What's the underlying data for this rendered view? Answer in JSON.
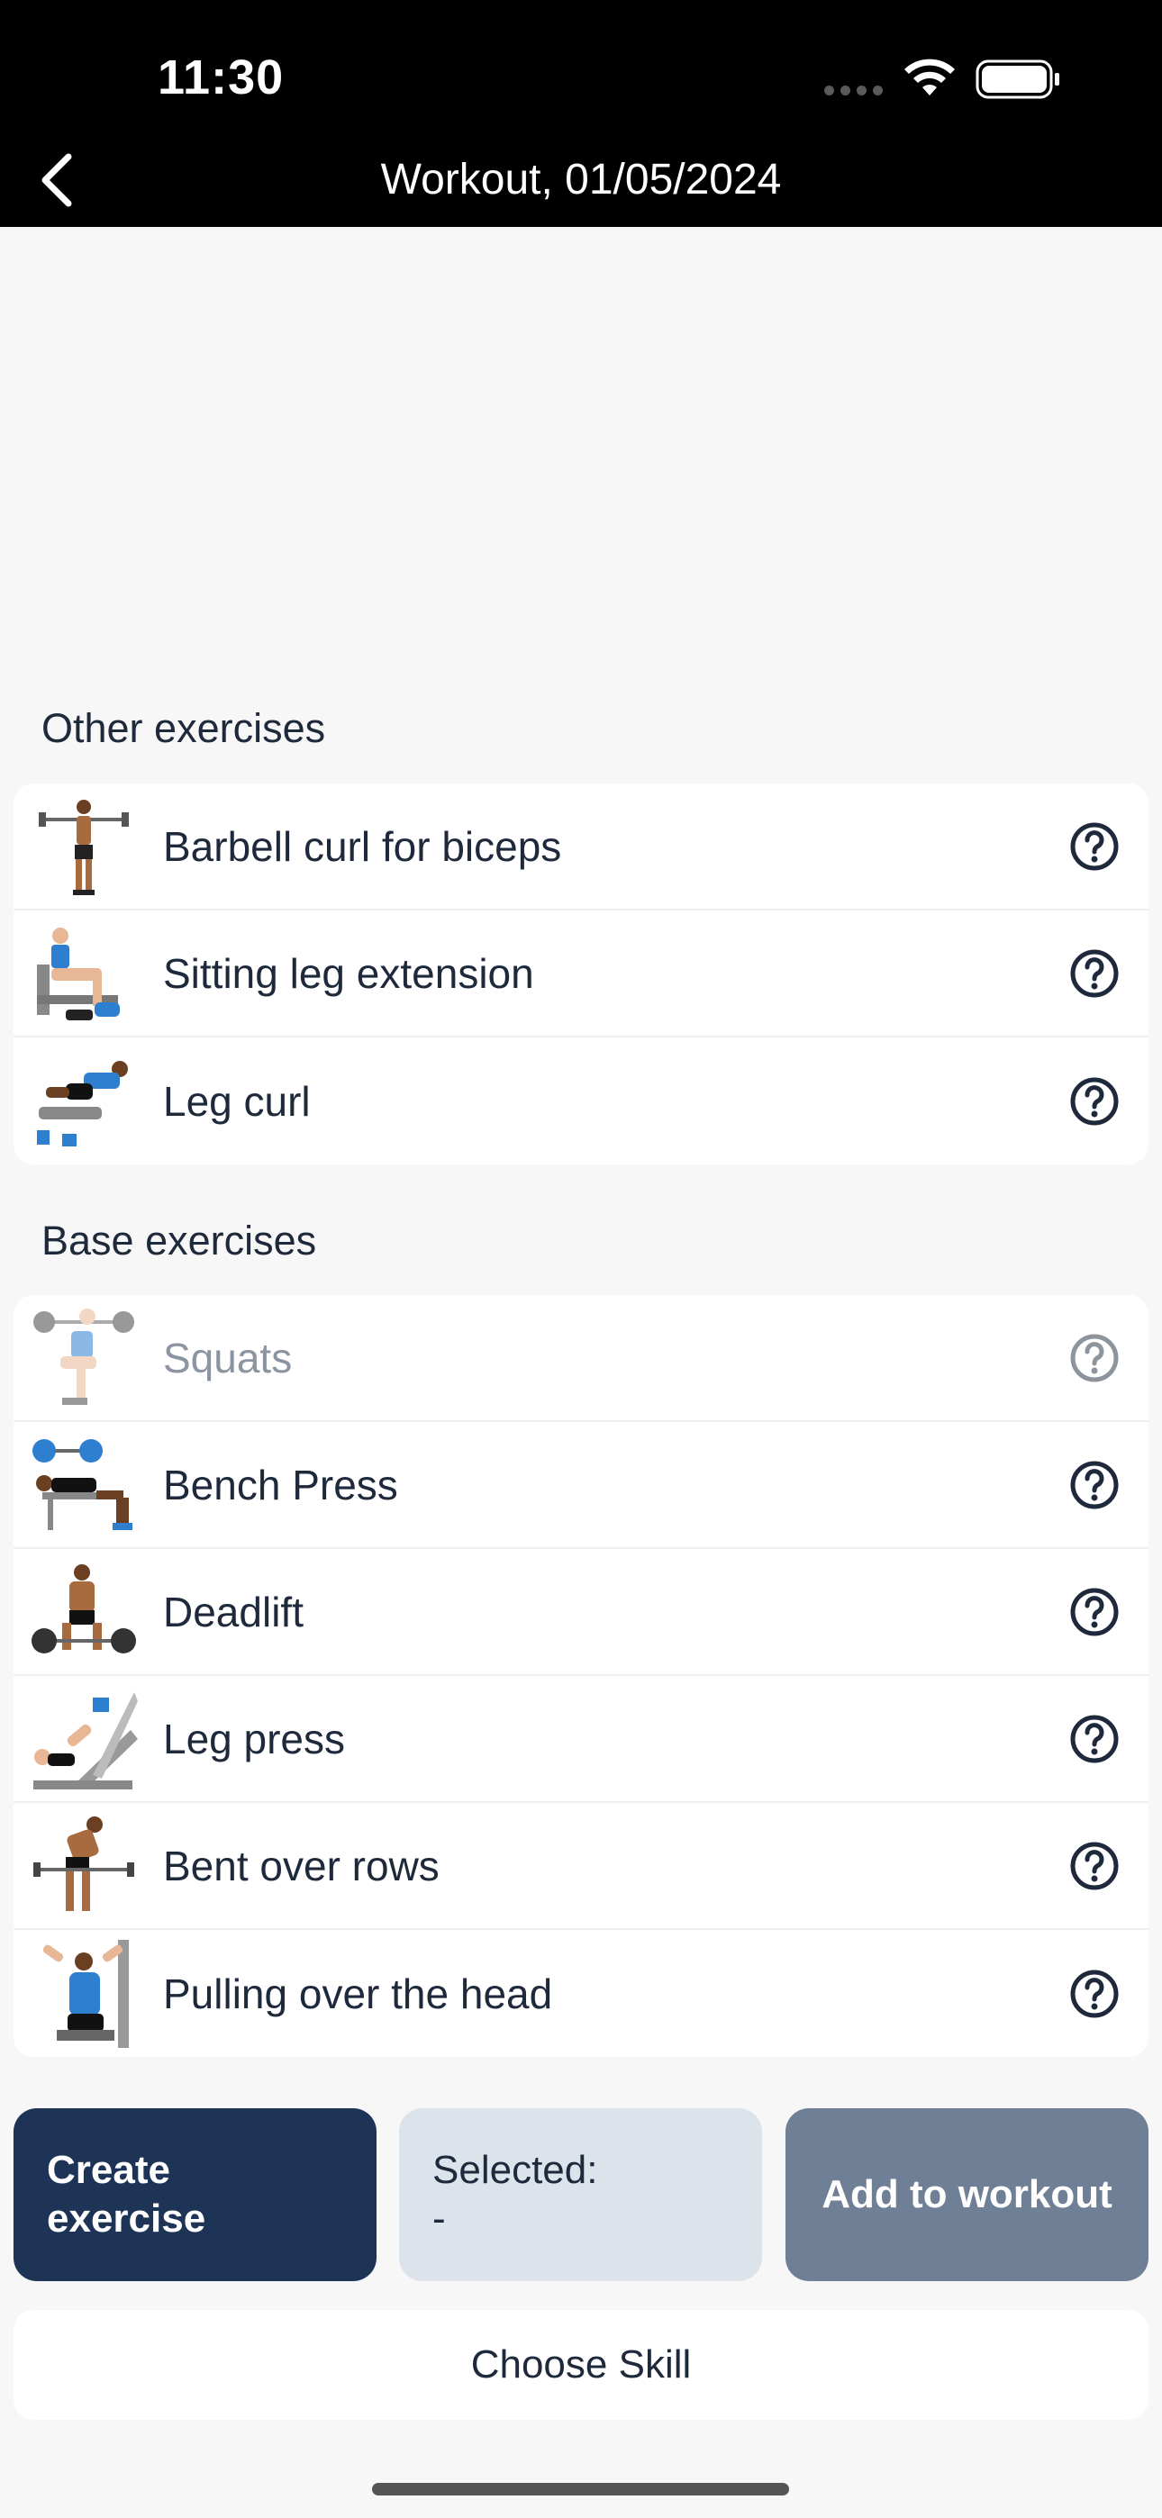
{
  "status_bar": {
    "time": "11:30"
  },
  "nav": {
    "title": "Workout, 01/05/2024"
  },
  "other_section": {
    "title": "Other exercises",
    "items": [
      {
        "label": "Barbell curl for biceps"
      },
      {
        "label": "Sitting leg extension"
      },
      {
        "label": "Leg curl"
      }
    ]
  },
  "base_section": {
    "title": "Base exercises",
    "items": [
      {
        "label": "Squats"
      },
      {
        "label": "Bench Press"
      },
      {
        "label": "Deadlift"
      },
      {
        "label": "Leg press"
      },
      {
        "label": "Bent over rows"
      },
      {
        "label": "Pulling over the head"
      }
    ]
  },
  "actions": {
    "create_line1": "Create",
    "create_line2": "exercise",
    "selected_line1": "Selected:",
    "selected_line2": "-",
    "add_label": "Add to workout",
    "choose_skill": "Choose Skill"
  },
  "colors": {
    "primary": "#1e3456",
    "selected_bg": "#dde3ea",
    "add_bg": "#6f7f95",
    "accent_blue": "#2f7fd0"
  }
}
